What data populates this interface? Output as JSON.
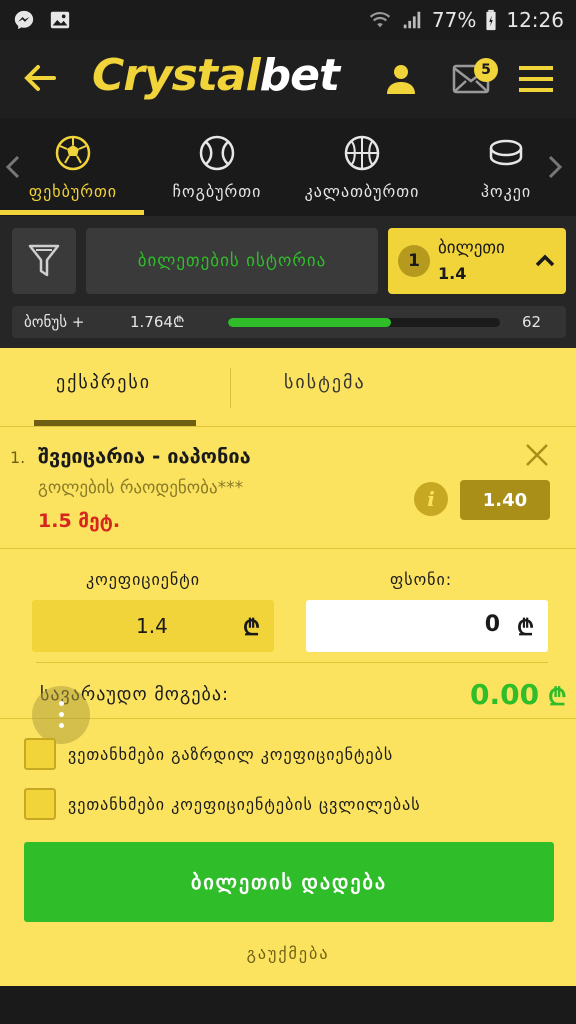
{
  "status_bar": {
    "battery": "77%",
    "time": "12:26"
  },
  "app": {
    "brand_part1": "Crystal",
    "brand_part2": "bet",
    "mail_count": "5"
  },
  "sports": [
    {
      "label": "ფეხბურთი",
      "icon": "soccer-ball-icon",
      "active": true
    },
    {
      "label": "ჩოგბურთი",
      "icon": "tennis-ball-icon",
      "active": false
    },
    {
      "label": "კალათბურთი",
      "icon": "basketball-icon",
      "active": false
    },
    {
      "label": "ჰოკეი",
      "icon": "hockey-puck-icon",
      "active": false
    }
  ],
  "ticket_bar": {
    "history_label": "ბილეთების ისტორია",
    "ticket_count": "1",
    "ticket_label": "ბილეთი",
    "ticket_odd": "1.4"
  },
  "bonus": {
    "label": "ბონუს +",
    "amount": "1.764₾",
    "count": "62",
    "progress_fraction": 0.6
  },
  "tabs": {
    "express": "ექსპრესი",
    "system": "სისტემა"
  },
  "bet": {
    "number": "1.",
    "title": "შვეიცარია - იაპონია",
    "market": "გოლების რაოდენობა***",
    "selection": "1.5 მეტ.",
    "odd": "1.40"
  },
  "form": {
    "coef_label": "კოეფიციენტი",
    "coef_value": "1.4",
    "stake_label": "ფსონი:",
    "stake_value": "0",
    "currency": "₾",
    "win_label": "სავარაუდო მოგება:",
    "win_value": "0.00"
  },
  "checks": {
    "increased": "ვეთანხმები გაზრდილ კოეფიციენტებს",
    "changes": "ვეთანხმები კოეფიციენტების ცვლილებას"
  },
  "actions": {
    "place": "ბილეთის დადება",
    "cancel": "გაუქმება"
  },
  "colors": {
    "accent": "#f1d33a",
    "panel": "#fbe360",
    "green": "#2fbd2a",
    "red": "#d6241e"
  }
}
